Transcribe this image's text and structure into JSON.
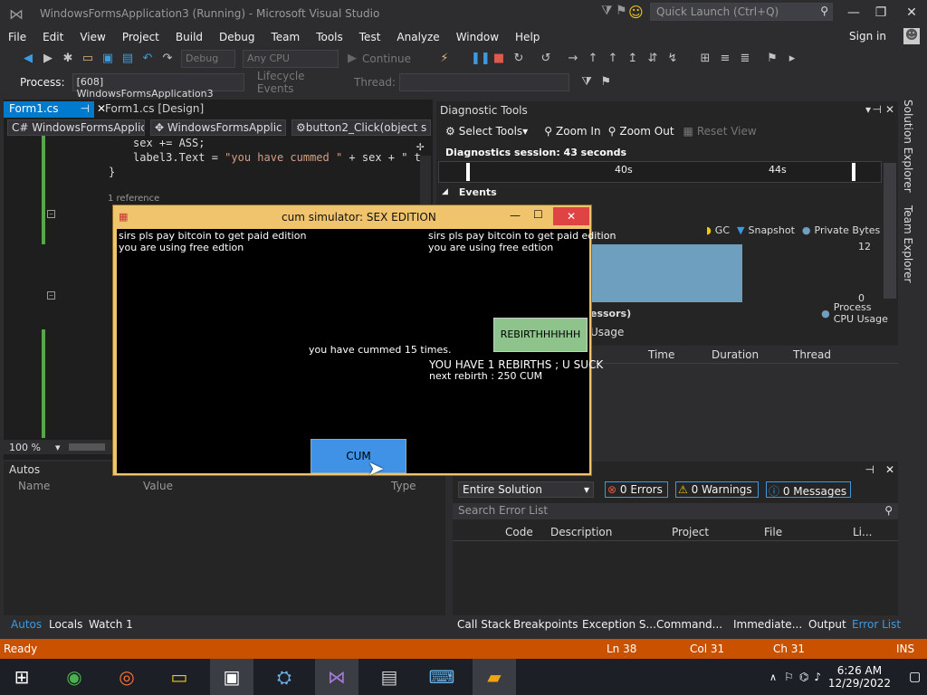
{
  "window": {
    "title": "WindowsFormsApplication3 (Running) - Microsoft Visual Studio",
    "quick_launch": "Quick Launch (Ctrl+Q)"
  },
  "menu": [
    "File",
    "Edit",
    "View",
    "Project",
    "Build",
    "Debug",
    "Team",
    "Tools",
    "Test",
    "Analyze",
    "Window",
    "Help"
  ],
  "sign_in": "Sign in",
  "toolbar": {
    "config": "Debug",
    "platform": "Any CPU",
    "continue": "Continue"
  },
  "process": {
    "label": "Process:",
    "value": "[608] WindowsFormsApplication3",
    "lifecycle": "Lifecycle Events",
    "thread_label": "Thread:"
  },
  "tabs": {
    "code": "Form1.cs",
    "design": "Form1.cs [Design]"
  },
  "nav": {
    "project": "WindowsFormsApplic",
    "class": "WindowsFormsApplic",
    "method": "button2_Click(object s"
  },
  "code": {
    "line1": "sex += ASS;",
    "line2_a": "label3.Text = ",
    "line2_b": "\"you have cummed \"",
    "line2_c": " + sex + \" t",
    "line3": "}",
    "ref": "1 reference"
  },
  "zoom": "100 %",
  "diagnostics": {
    "title": "Diagnostic Tools",
    "select_tools": "Select Tools",
    "zoom_in": "Zoom In",
    "zoom_out": "Zoom Out",
    "reset_view": "Reset View",
    "session": "Diagnostics session: 43 seconds",
    "t40": "40s",
    "t44": "44s",
    "events": "Events",
    "gc": "GC",
    "snapshot": "Snapshot",
    "private_bytes": "Private Bytes",
    "mem_max": "12",
    "mem_min": "0",
    "processors": "essors)",
    "cpu": "Process CPU Usage",
    "usage": "Usage",
    "col_time": "Time",
    "col_duration": "Duration",
    "col_thread": "Thread"
  },
  "sidetabs": [
    "Solution Explorer",
    "Team Explorer"
  ],
  "autos": {
    "title": "Autos",
    "col_name": "Name",
    "col_value": "Value",
    "col_type": "Type"
  },
  "errors": {
    "scope": "Entire Solution",
    "errors": "0 Errors",
    "warnings": "0 Warnings",
    "messages": "0 Messages",
    "search": "Search Error List",
    "col_code": "Code",
    "col_desc": "Description",
    "col_project": "Project",
    "col_file": "File",
    "col_line": "Li..."
  },
  "bottom_left_tabs": [
    "Autos",
    "Locals",
    "Watch 1"
  ],
  "bottom_right_tabs": [
    "Call Stack",
    "Breakpoints",
    "Exception S...",
    "Command...",
    "Immediate...",
    "Output",
    "Error List"
  ],
  "status": {
    "state": "Ready",
    "ln": "Ln 38",
    "col": "Col 31",
    "ch": "Ch 31",
    "ins": "INS"
  },
  "clock": {
    "time": "6:26 AM",
    "date": "12/29/2022"
  },
  "app": {
    "title": "cum simulator: SEX EDITION",
    "pay_a": "sirs pls pay bitcoin to  get paid edition",
    "free_a": "you are using free edtion",
    "pay_b": "sirs pls pay bitcoin to  get paid edition",
    "free_b": "you are using free edtion",
    "cummed": "you have cummed 15 times.",
    "rebirth_btn": "REBIRTHHHHHH",
    "rebirths": "YOU HAVE  1 REBIRTHS ; U SUCK",
    "next": "next rebirth : 250 CUM",
    "cum_btn": "CUM"
  }
}
